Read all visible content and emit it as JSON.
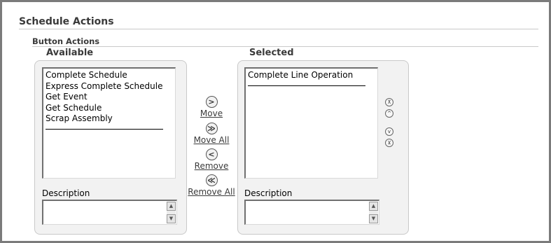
{
  "section": {
    "title": "Schedule Actions"
  },
  "subsection": {
    "title": "Button Actions"
  },
  "available": {
    "heading": "Available",
    "items": [
      "Complete Schedule",
      "Express Complete Schedule",
      "Get Event",
      "Get Schedule",
      "Scrap Assembly"
    ],
    "description_label": "Description",
    "description_value": ""
  },
  "selected": {
    "heading": "Selected",
    "items": [
      "Complete Line Operation"
    ],
    "description_label": "Description",
    "description_value": ""
  },
  "shuttle": {
    "move_label": "Move",
    "move_all_label": "Move All",
    "remove_label": "Remove",
    "remove_all_label": "Remove All",
    "move_icon": ">",
    "move_all_icon": "≫",
    "remove_icon": "<",
    "remove_all_icon": "≪"
  },
  "ordering": {
    "top_icon": "⊼",
    "up_icon": "^",
    "down_icon": "v",
    "bottom_icon": "⊻"
  }
}
